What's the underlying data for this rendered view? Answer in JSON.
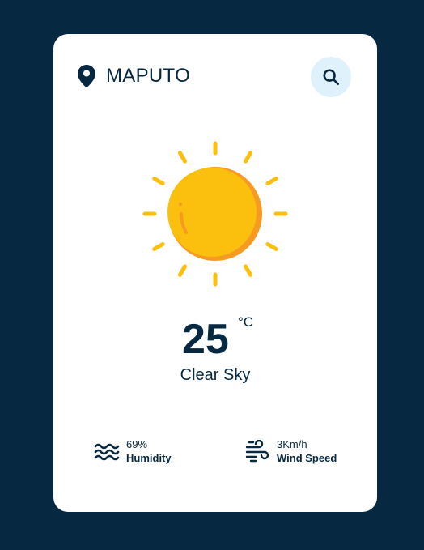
{
  "location": {
    "city": "MAPUTO",
    "icon": "map-pin-icon"
  },
  "search": {
    "icon": "search-icon",
    "color": "#dff1fb"
  },
  "weather": {
    "icon": "sun-icon",
    "temperature": "25",
    "unit": "°C",
    "description": "Clear Sky"
  },
  "details": {
    "humidity": {
      "value": "69%",
      "label": "Humidity",
      "icon": "waves-icon"
    },
    "wind": {
      "value": "3Km/h",
      "label": "Wind Speed",
      "icon": "wind-icon"
    }
  },
  "colors": {
    "background": "#062840",
    "card": "#ffffff",
    "sun": "#fbbf0e",
    "sun_shadow": "#f79a21",
    "text": "#062840"
  }
}
